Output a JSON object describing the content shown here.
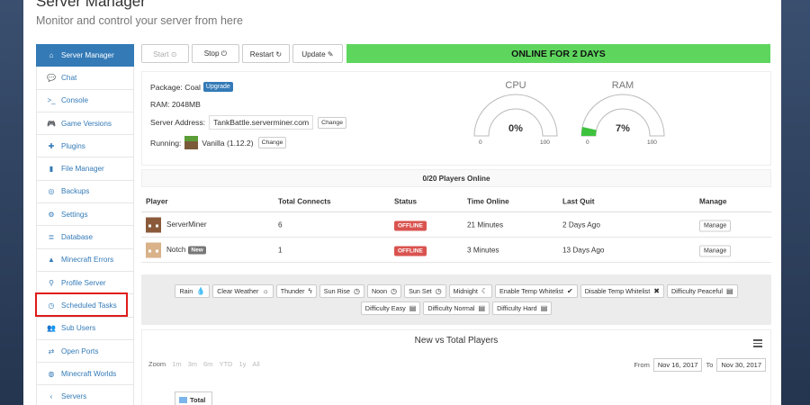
{
  "header": {
    "title": "Server Manager",
    "subtitle": "Monitor and control your server from here"
  },
  "sidebar": {
    "items": [
      {
        "label": "Server Manager",
        "icon": "home-icon",
        "glyph": "⌂"
      },
      {
        "label": "Chat",
        "icon": "chat-icon",
        "glyph": "💬"
      },
      {
        "label": "Console",
        "icon": "terminal-icon",
        "glyph": ">_"
      },
      {
        "label": "Game Versions",
        "icon": "gamepad-icon",
        "glyph": "🎮"
      },
      {
        "label": "Plugins",
        "icon": "puzzle-icon",
        "glyph": "✚"
      },
      {
        "label": "File Manager",
        "icon": "file-icon",
        "glyph": "▮"
      },
      {
        "label": "Backups",
        "icon": "backup-icon",
        "glyph": "◎"
      },
      {
        "label": "Settings",
        "icon": "gear-icon",
        "glyph": "⚙"
      },
      {
        "label": "Database",
        "icon": "database-icon",
        "glyph": "≣"
      },
      {
        "label": "Minecraft Errors",
        "icon": "warning-icon",
        "glyph": "▲"
      },
      {
        "label": "Profile Server",
        "icon": "search-icon",
        "glyph": "⚲"
      },
      {
        "label": "Scheduled Tasks",
        "icon": "clock-icon",
        "glyph": "◷"
      },
      {
        "label": "Sub Users",
        "icon": "users-icon",
        "glyph": "👥"
      },
      {
        "label": "Open Ports",
        "icon": "link-icon",
        "glyph": "⇄"
      },
      {
        "label": "Minecraft Worlds",
        "icon": "globe-icon",
        "glyph": "◍"
      },
      {
        "label": "Servers",
        "icon": "chevron-left-icon",
        "glyph": "‹"
      }
    ]
  },
  "toolbar": {
    "start": "Start ⊙",
    "stop": "Stop ⏻",
    "restart": "Restart ↻",
    "update": "Update ✎",
    "status": "ONLINE FOR 2 DAYS",
    "status_color": "#5ed65e"
  },
  "info": {
    "package_label": "Package:",
    "package_value": "Coal",
    "upgrade": "Upgrade",
    "ram_label": "RAM:",
    "ram_value": "2048MB",
    "address_label": "Server Address:",
    "address_value": "TankBattle.serverminer.com",
    "running_label": "Running:",
    "running_value": "Vanilla (1.12.2)",
    "change": "Change"
  },
  "gauges": {
    "cpu": {
      "title": "CPU",
      "value": "0%",
      "fraction": 0.0,
      "min": "0",
      "max": "100"
    },
    "ram": {
      "title": "RAM",
      "value": "7%",
      "fraction": 0.07,
      "min": "0",
      "max": "100"
    }
  },
  "players": {
    "header": "0/20 Players Online",
    "columns": [
      "Player",
      "Total Connects",
      "Status",
      "Time Online",
      "Last Quit",
      "Manage"
    ],
    "rows": [
      {
        "name": "ServerMiner",
        "connects": "6",
        "status": "OFFLINE",
        "time": "21 Minutes",
        "last_quit": "2 Days Ago",
        "manage": "Manage",
        "new_badge": ""
      },
      {
        "name": "Notch",
        "connects": "1",
        "status": "OFFLINE",
        "time": "3 Minutes",
        "last_quit": "13 Days Ago",
        "manage": "Manage",
        "new_badge": "New"
      }
    ]
  },
  "commands": [
    {
      "label": "Rain",
      "icon": "drop-icon",
      "glyph": "💧"
    },
    {
      "label": "Clear Weather",
      "icon": "sun-icon",
      "glyph": "☼"
    },
    {
      "label": "Thunder",
      "icon": "bolt-icon",
      "glyph": "ϟ"
    },
    {
      "label": "Sun Rise",
      "icon": "clock-icon",
      "glyph": "◷"
    },
    {
      "label": "Noon",
      "icon": "clock-icon",
      "glyph": "◷"
    },
    {
      "label": "Sun Set",
      "icon": "clock-icon",
      "glyph": "◷"
    },
    {
      "label": "Midnight",
      "icon": "moon-icon",
      "glyph": "☾"
    },
    {
      "label": "Enable Temp Whitelist",
      "icon": "check-icon",
      "glyph": "✔"
    },
    {
      "label": "Disable Temp Whitelist",
      "icon": "x-icon",
      "glyph": "✖"
    },
    {
      "label": "Difficulty Peaceful",
      "icon": "book-icon",
      "glyph": "▤"
    },
    {
      "label": "Difficulty Easy",
      "icon": "book-icon",
      "glyph": "▤"
    },
    {
      "label": "Difficulty Normal",
      "icon": "book-icon",
      "glyph": "▤"
    },
    {
      "label": "Difficulty Hard",
      "icon": "book-icon",
      "glyph": "▤"
    }
  ],
  "chart": {
    "title": "New vs Total Players",
    "zoom_label": "Zoom",
    "zoom_options": [
      "1m",
      "3m",
      "6m",
      "YTD",
      "1y",
      "All"
    ],
    "from_label": "From",
    "from_value": "Nov 16, 2017",
    "to_label": "To",
    "to_value": "Nov 30, 2017",
    "legend": "Total"
  },
  "colors": {
    "accent": "#337ab7",
    "offline": "#d9534f",
    "highlight": "#e01b1b",
    "gauge_fill": "#3ec23e"
  }
}
